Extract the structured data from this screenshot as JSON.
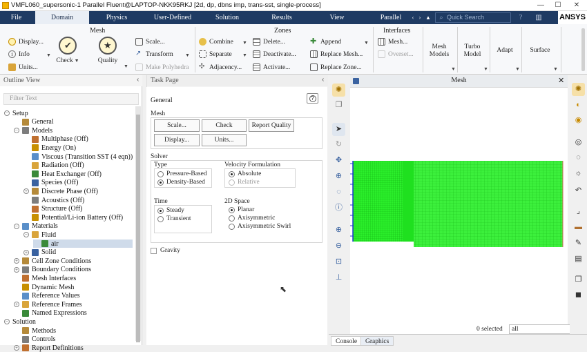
{
  "window": {
    "title": "VMFL060_supersonic-1 Parallel Fluent@LAPTOP-NKK95RKJ  [2d, dp, dbns imp, trans-sst, single-process]",
    "controls": [
      "—",
      "☐",
      "✕"
    ]
  },
  "menubar": {
    "items": [
      "File",
      "Domain",
      "Physics",
      "User-Defined",
      "Solution",
      "Results",
      "View",
      "Parallel"
    ],
    "active": "Domain",
    "search_placeholder": "Quick Search",
    "brand": "ANSYS"
  },
  "ribbon": {
    "mesh": {
      "title": "Mesh",
      "display": "Display...",
      "info": "Info",
      "units": "Units...",
      "check": "Check",
      "quality": "Quality",
      "scale": "Scale...",
      "transform": "Transform",
      "make_polyhedra": "Make Polyhedra"
    },
    "zones": {
      "title": "Zones",
      "combine": "Combine",
      "separate": "Separate",
      "adjacency": "Adjacency...",
      "delete": "Delete...",
      "deactivate": "Deactivate...",
      "activate": "Activate...",
      "append": "Append",
      "replace_mesh": "Replace Mesh...",
      "replace_zone": "Replace Zone..."
    },
    "interfaces": {
      "title": "Interfaces",
      "mesh": "Mesh...",
      "overset": "Overset..."
    },
    "mesh_models": "Mesh Models",
    "turbo_model": "Turbo Model",
    "adapt": "Adapt",
    "surface": "Surface"
  },
  "outline": {
    "title": "Outline View",
    "filter_placeholder": "Filter Text",
    "items": [
      {
        "label": "Setup",
        "level": 0,
        "exp": "−"
      },
      {
        "label": "General",
        "level": 1
      },
      {
        "label": "Models",
        "level": 1,
        "exp": "−"
      },
      {
        "label": "Multiphase (Off)",
        "level": 2
      },
      {
        "label": "Energy (On)",
        "level": 2
      },
      {
        "label": "Viscous (Transition SST (4 eqn))",
        "level": 2
      },
      {
        "label": "Radiation (Off)",
        "level": 2
      },
      {
        "label": "Heat Exchanger (Off)",
        "level": 2
      },
      {
        "label": "Species (Off)",
        "level": 2
      },
      {
        "label": "Discrete Phase (Off)",
        "level": 2,
        "exp": "+"
      },
      {
        "label": "Acoustics (Off)",
        "level": 2
      },
      {
        "label": "Structure (Off)",
        "level": 2
      },
      {
        "label": "Potential/Li-ion Battery (Off)",
        "level": 2
      },
      {
        "label": "Materials",
        "level": 1,
        "exp": "−"
      },
      {
        "label": "Fluid",
        "level": 2,
        "exp": "−"
      },
      {
        "label": "air",
        "level": 3,
        "selected": true
      },
      {
        "label": "Solid",
        "level": 2,
        "exp": "+"
      },
      {
        "label": "Cell Zone Conditions",
        "level": 1,
        "exp": "+"
      },
      {
        "label": "Boundary Conditions",
        "level": 1,
        "exp": "+"
      },
      {
        "label": "Mesh Interfaces",
        "level": 1
      },
      {
        "label": "Dynamic Mesh",
        "level": 1
      },
      {
        "label": "Reference Values",
        "level": 1
      },
      {
        "label": "Reference Frames",
        "level": 1,
        "exp": "+"
      },
      {
        "label": "Named Expressions",
        "level": 1
      },
      {
        "label": "Solution",
        "level": 0,
        "exp": "−"
      },
      {
        "label": "Methods",
        "level": 1
      },
      {
        "label": "Controls",
        "level": 1
      },
      {
        "label": "Report Definitions",
        "level": 1,
        "exp": "+"
      }
    ]
  },
  "taskpage": {
    "title": "Task Page",
    "heading": "General",
    "mesh_label": "Mesh",
    "buttons": {
      "scale": "Scale...",
      "check": "Check",
      "report_quality": "Report Quality",
      "display": "Display...",
      "units": "Units..."
    },
    "solver_label": "Solver",
    "type_label": "Type",
    "type_options": [
      "Pressure-Based",
      "Density-Based"
    ],
    "type_selected": 1,
    "velocity_label": "Velocity Formulation",
    "velocity_options": [
      "Absolute",
      "Relative"
    ],
    "time_label": "Time",
    "time_options": [
      "Steady",
      "Transient"
    ],
    "space_label": "2D Space",
    "space_options": [
      "Planar",
      "Axisymmetric",
      "Axisymmetric Swirl"
    ],
    "gravity": "Gravity",
    "help": "?"
  },
  "graphics": {
    "title": "Mesh",
    "selected_label": "0 selected",
    "selection_value": "all"
  },
  "bottom_tabs": [
    "Console",
    "Graphics"
  ],
  "colors": {
    "menubar": "#1f3b63",
    "mesh": "#1fe01f",
    "inlet": "#1f3bd0",
    "outlet": "#e06060"
  }
}
